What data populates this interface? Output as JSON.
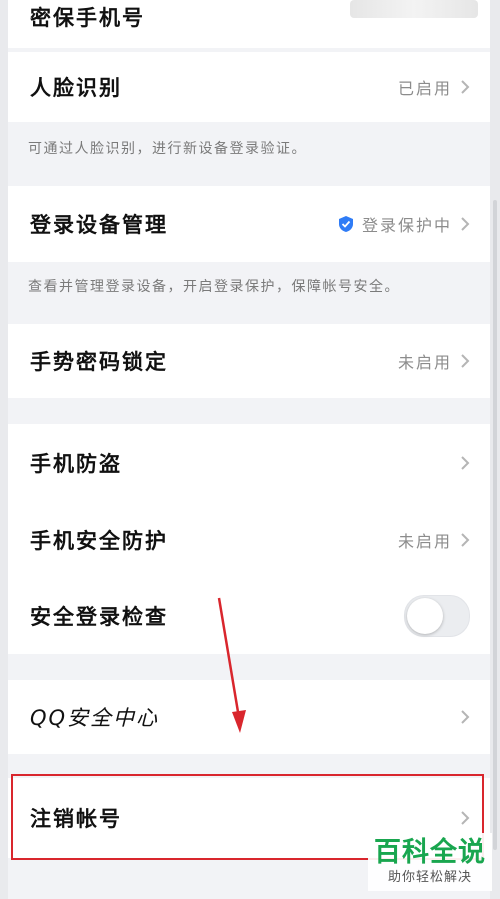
{
  "rows": {
    "phone": {
      "label": "密保手机号"
    },
    "face": {
      "label": "人脸识别",
      "value": "已启用"
    },
    "face_note": "可通过人脸识别，进行新设备登录验证。",
    "devices": {
      "label": "登录设备管理",
      "value": "登录保护中"
    },
    "devices_note": "查看并管理登录设备，开启登录保护，保障帐号安全。",
    "gesture": {
      "label": "手势密码锁定",
      "value": "未启用"
    },
    "antitheft": {
      "label": "手机防盗"
    },
    "phone_security": {
      "label": "手机安全防护",
      "value": "未启用"
    },
    "login_check": {
      "label": "安全登录检查",
      "toggle_on": false
    },
    "qq_center": {
      "label": "QQ安全中心"
    },
    "cancel_account": {
      "label": "注销帐号"
    }
  },
  "watermark": {
    "main": "百科全说",
    "sub": "助你轻松解决"
  },
  "colors": {
    "annotation": "#d9262d",
    "shield": "#2f7cf6",
    "watermark": "#19a64f"
  }
}
